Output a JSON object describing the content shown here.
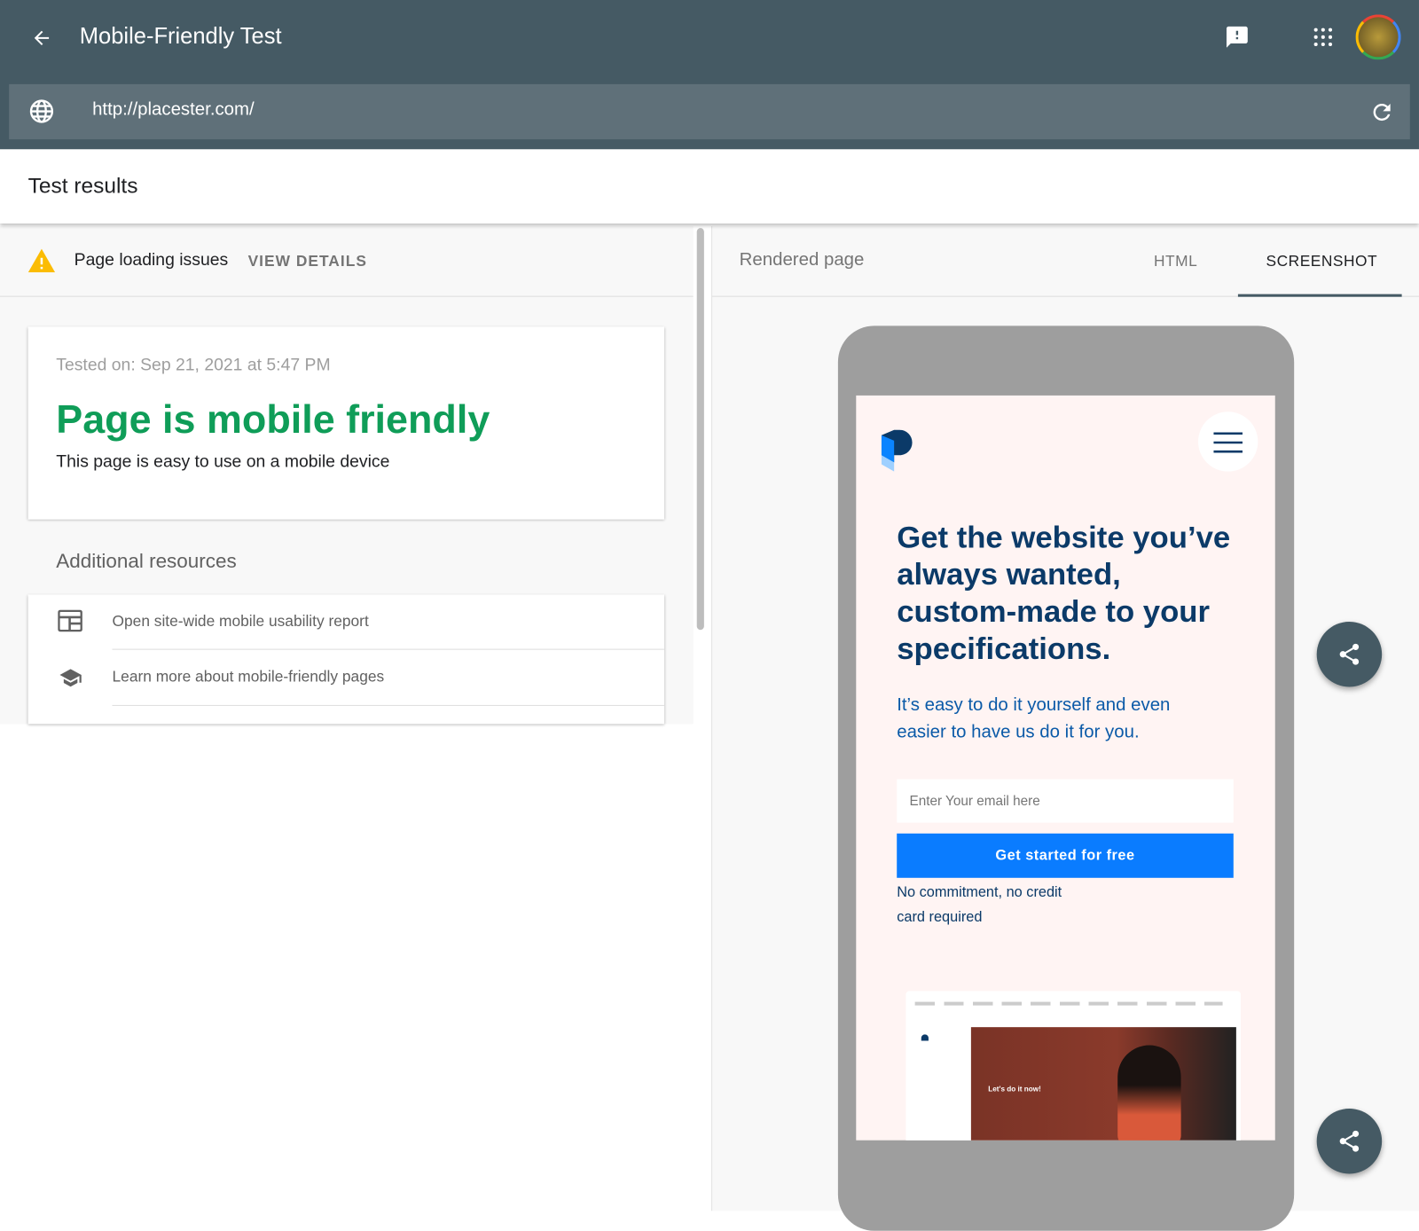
{
  "header": {
    "title": "Mobile-Friendly Test",
    "url": "http://placester.com/",
    "icons": [
      "arrow-back-icon",
      "feedback-icon",
      "apps-grid-icon",
      "avatar",
      "globe-icon",
      "refresh-icon"
    ]
  },
  "results": {
    "title": "Test results"
  },
  "issues": {
    "label": "Page loading issues",
    "action": "VIEW DETAILS",
    "icon": "warning-icon",
    "icon_color": "#fbbc04"
  },
  "summary": {
    "tested_on": "Tested on: Sep 21, 2021 at 5:47 PM",
    "headline": "Page is mobile friendly",
    "headline_color": "#0f9d58",
    "description": "This page is easy to use on a mobile device"
  },
  "resources": {
    "title": "Additional resources",
    "items": [
      {
        "label": "Open site-wide mobile usability report",
        "icon": "report-icon"
      },
      {
        "label": "Learn more about mobile-friendly pages",
        "icon": "school-icon"
      }
    ]
  },
  "rendered": {
    "title": "Rendered page",
    "tabs": [
      {
        "label": "HTML",
        "active": false
      },
      {
        "label": "SCREENSHOT",
        "active": true
      }
    ]
  },
  "site": {
    "headline": "Get the website you’ve always wanted, custom-made to your specifications.",
    "sub": "It’s easy to do it yourself and even easier to have us do it for you.",
    "email_placeholder": "Enter Your email here",
    "cta": "Get started for free",
    "note": "No commitment, no credit card required",
    "preview_heading": "Let's do it now!",
    "brand_color": "#0a7cff",
    "text_color": "#0b3a68"
  }
}
